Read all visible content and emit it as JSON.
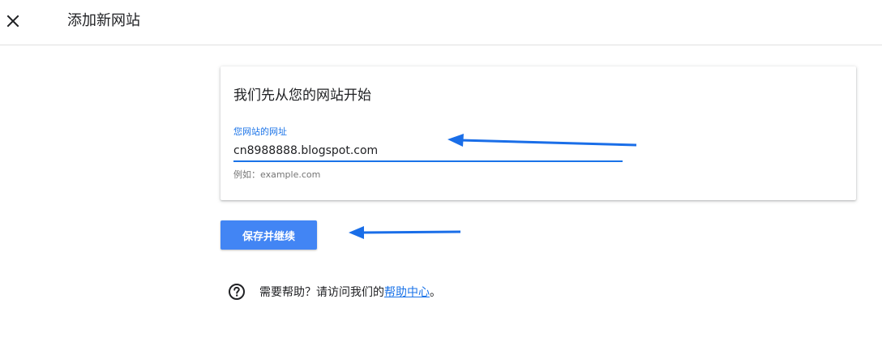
{
  "header": {
    "title": "添加新网站",
    "close_icon": "close-icon"
  },
  "card": {
    "heading": "我们先从您的网站开始",
    "field_label": "您网站的网址",
    "field_value": "cn8988888.blogspot.com",
    "field_hint": "例如：example.com"
  },
  "actions": {
    "save_label": "保存并继续"
  },
  "help": {
    "icon": "help-circle-icon",
    "prefix": "需要帮助？请访问我们的",
    "link_label": "帮助中心",
    "suffix": "。"
  },
  "colors": {
    "accent": "#1a73e8",
    "button": "#4285f4",
    "annotation_arrow": "#1a6ee8"
  }
}
